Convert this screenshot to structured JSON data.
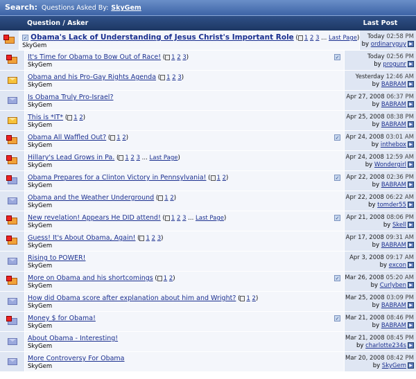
{
  "header": {
    "search_label": "Search:",
    "search_sub": "Questions Asked By:",
    "user": "SkyGem",
    "col_question": "Question / Asker",
    "col_last": "Last Post"
  },
  "rows": [
    {
      "icon": "hot",
      "title": "Obama's Lack of Understanding of Jesus Christ's Important Role",
      "bold": true,
      "pages": "1 2 3 ... Last Page",
      "asker": "SkyGem",
      "date": "Today",
      "time": "02:58 PM",
      "by": "ordinaryguy",
      "check_inline": true
    },
    {
      "icon": "hot",
      "title": "It's Time for Obama to Bow Out of Race!",
      "pages": "1 2 3",
      "asker": "SkyGem",
      "date": "Today",
      "time": "02:56 PM",
      "by": "progunr",
      "check": true
    },
    {
      "icon": "new",
      "title": "Obama and his Pro-Gay Rights Agenda",
      "pages": "1 2 3",
      "asker": "SkyGem",
      "date": "Yesterday",
      "time": "12:46 AM",
      "by": "BABRAM"
    },
    {
      "icon": "env",
      "title": "Is Obama Truly Pro-Israel?",
      "pages": "",
      "asker": "SkyGem",
      "date": "Apr 27, 2008",
      "time": "06:37 PM",
      "by": "BABRAM"
    },
    {
      "icon": "new",
      "title": "This is *IT*",
      "pages": "1 2",
      "asker": "SkyGem",
      "date": "Apr 25, 2008",
      "time": "08:38 PM",
      "by": "BABRAM"
    },
    {
      "icon": "hot",
      "title": "Obama All Waffled Out?",
      "pages": "1 2",
      "asker": "SkyGem",
      "date": "Apr 24, 2008",
      "time": "03:01 AM",
      "by": "inthebox",
      "check": true
    },
    {
      "icon": "hot",
      "title": "Hillary's Lead Grows in Pa.",
      "pages": "1 2 3 ... Last Page",
      "asker": "SkyGem",
      "date": "Apr 24, 2008",
      "time": "12:59 AM",
      "by": "Wondergirl"
    },
    {
      "icon": "lock",
      "title": "Obama Prepares for a Clinton Victory in Pennsylvania!",
      "pages": "1 2",
      "asker": "SkyGem",
      "date": "Apr 22, 2008",
      "time": "02:36 PM",
      "by": "BABRAM",
      "check": true
    },
    {
      "icon": "env",
      "title": "Obama and the Weather Underground",
      "pages": "1 2",
      "asker": "SkyGem",
      "date": "Apr 22, 2008",
      "time": "06:22 AM",
      "by": "tomder55"
    },
    {
      "icon": "hot",
      "title": "New revelation! Appears He DID attend!",
      "pages": "1 2 3 ... Last Page",
      "asker": "SkyGem",
      "date": "Apr 21, 2008",
      "time": "08:06 PM",
      "by": "Skell",
      "check": true
    },
    {
      "icon": "hot",
      "title": "Guess! It's About Obama, Again!",
      "pages": "1 2 3",
      "asker": "SkyGem",
      "date": "Apr 17, 2008",
      "time": "09:31 AM",
      "by": "BABRAM"
    },
    {
      "icon": "env",
      "title": "Rising to POWER!",
      "pages": "",
      "asker": "SkyGem",
      "date": "Apr 3, 2008",
      "time": "09:17 AM",
      "by": "excon"
    },
    {
      "icon": "hot",
      "title": "More on Obama and his shortcomings",
      "pages": "1 2",
      "asker": "SkyGem",
      "date": "Mar 26, 2008",
      "time": "05:20 AM",
      "by": "Curlyben",
      "check": true
    },
    {
      "icon": "env",
      "title": "How did Obama score after explanation about him and Wright?",
      "pages": "1 2",
      "asker": "SkyGem",
      "date": "Mar 25, 2008",
      "time": "03:09 PM",
      "by": "BABRAM"
    },
    {
      "icon": "lock",
      "title": "Money $ for Obama!",
      "pages": "",
      "asker": "SkyGem",
      "date": "Mar 21, 2008",
      "time": "08:46 PM",
      "by": "BABRAM",
      "check": true
    },
    {
      "icon": "env",
      "title": "About Obama - Interesting!",
      "pages": "",
      "asker": "SkyGem",
      "date": "Mar 21, 2008",
      "time": "08:45 PM",
      "by": "charlotte234s"
    },
    {
      "icon": "env",
      "title": "More Controversy For Obama",
      "pages": "",
      "asker": "SkyGem",
      "date": "Mar 20, 2008",
      "time": "08:42 PM",
      "by": "SkyGem"
    }
  ]
}
